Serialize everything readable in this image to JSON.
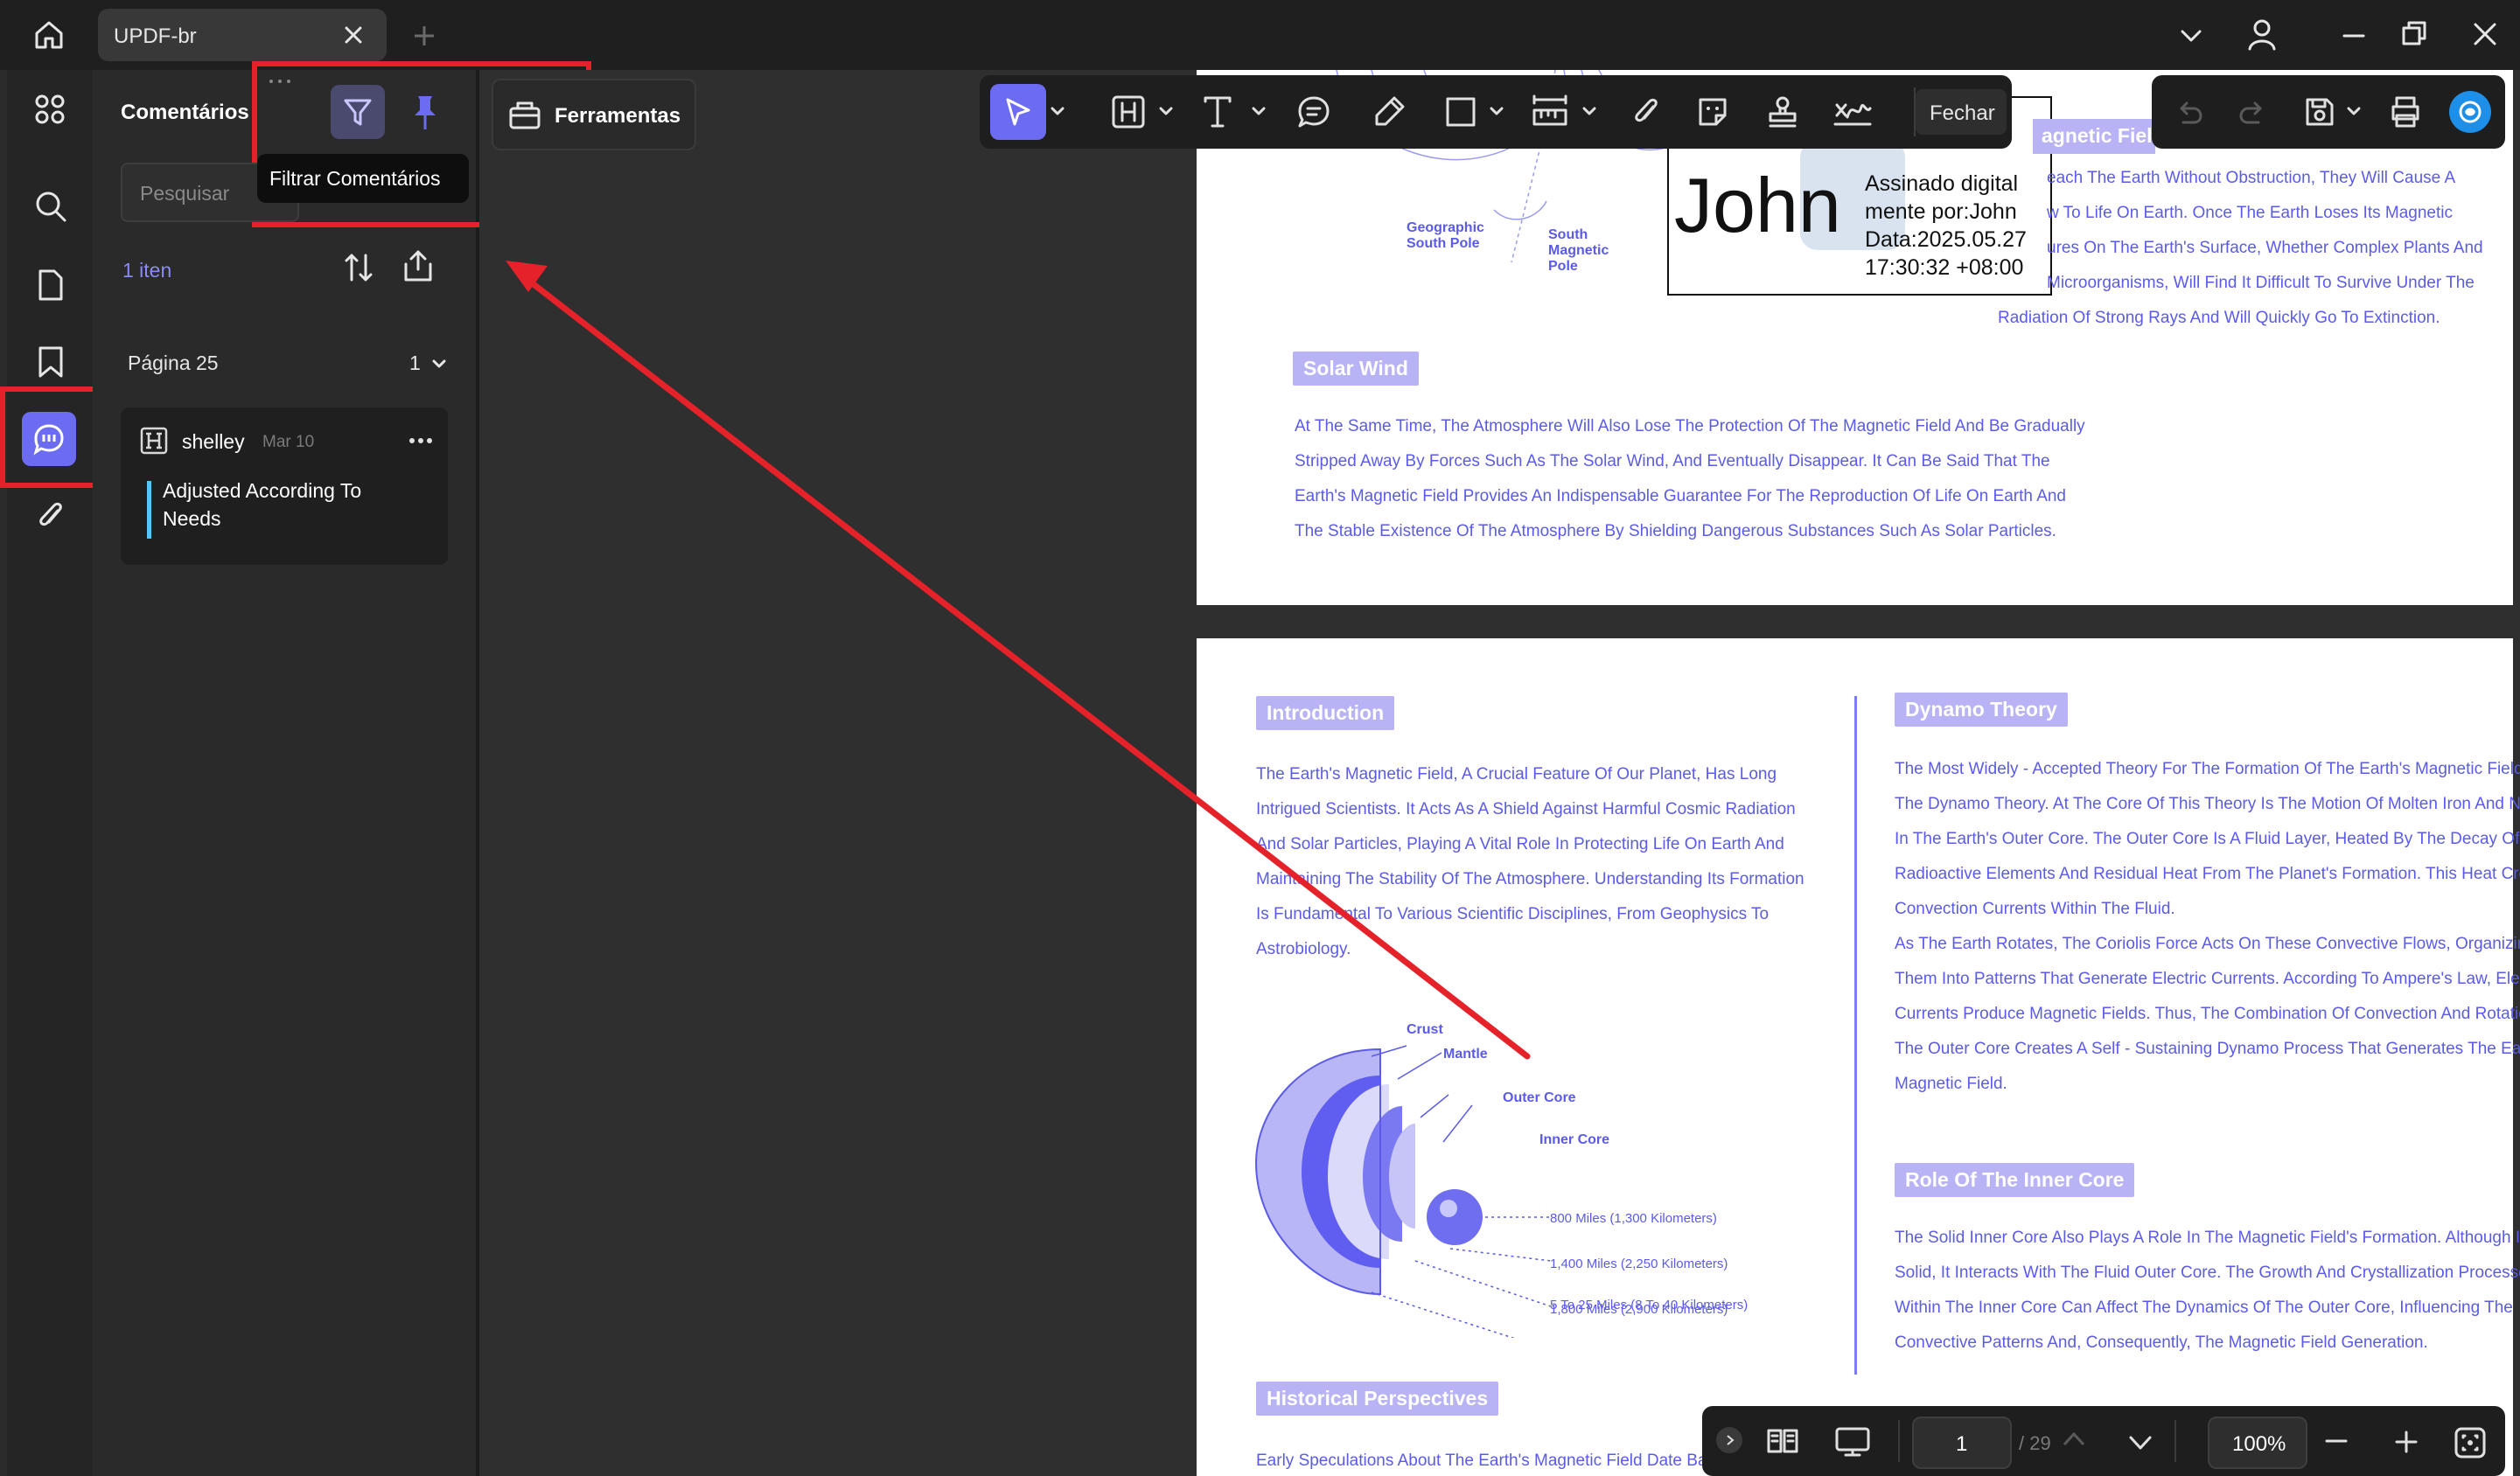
{
  "titlebar": {
    "tab_title": "UPDF-br"
  },
  "panel": {
    "title": "Comentários",
    "tooltip": "Filtrar Comentários",
    "search_placeholder": "Pesquisar",
    "count": "1 iten",
    "page_label": "Página 25",
    "page_count": "1",
    "comment": {
      "author": "shelley",
      "date": "Mar 10",
      "text_line1": "Adjusted According To",
      "text_line2": "Needs"
    }
  },
  "tools": {
    "label": "Ferramentas",
    "close_label": "Fechar"
  },
  "signature": {
    "name": "John",
    "line1": "Assinado digital",
    "line2": "mente por:John",
    "line3": "Data:2025.05.27",
    "line4": "17:30:32 +08:00"
  },
  "page1": {
    "diagram_labels": {
      "geo1": "Geographic",
      "geo2": "South Pole",
      "south1": "South",
      "south2": "Magnetic",
      "south3": "Pole",
      "magnetic_field_partial": "agnetic Fiel"
    },
    "right_lines": [
      "each The Earth Without Obstruction, They Will Cause A",
      "w To Life On Earth. Once The Earth Loses Its Magnetic",
      "ures On The Earth's Surface, Whether Complex Plants And",
      "Microorganisms, Will Find It Difficult To Survive Under The",
      "Radiation Of Strong Rays And Will Quickly Go To Extinction."
    ],
    "solar_heading": "Solar Wind",
    "solar_lines": [
      "At The Same Time, The Atmosphere Will Also Lose The Protection Of The Magnetic Field And Be Gradually",
      "Stripped Away By Forces Such As The Solar Wind, And Eventually Disappear. It Can Be Said That The",
      "Earth's Magnetic Field Provides An Indispensable Guarantee For The Reproduction Of Life On Earth And",
      "The Stable Existence Of The Atmosphere By Shielding Dangerous Substances Such As Solar Particles."
    ]
  },
  "page2": {
    "intro_heading": "Introduction",
    "intro_lines": [
      "The Earth's Magnetic Field, A Crucial Feature Of Our Planet, Has Long",
      "Intrigued Scientists. It Acts As A Shield Against Harmful Cosmic Radiation",
      "And Solar Particles, Playing A Vital Role In Protecting Life On Earth And",
      "Maintaining The Stability Of The Atmosphere. Understanding Its Formation",
      "Is Fundamental To Various Scientific Disciplines, From Geophysics To",
      "Astrobiology."
    ],
    "earth_labels": {
      "crust": "Crust",
      "mantle": "Mantle",
      "outer_core": "Outer Core",
      "inner_core": "Inner Core",
      "d1": "800 Miles (1,300 Kilometers)",
      "d2": "1,400 Miles (2,250 Kilometers)",
      "d3": "1,800 Miles (2,900 Kilometers)",
      "d4": "5 To 25 Miles (8 To 40 Kilometers)"
    },
    "dynamo_heading": "Dynamo Theory",
    "dynamo_lines": [
      "The Most Widely - Accepted Theory For The Formation Of The Earth's Magnetic Field",
      "The Dynamo Theory. At The Core Of This Theory Is The Motion Of Molten Iron And N",
      "In The Earth's Outer Core. The Outer Core Is A Fluid Layer, Heated By The Decay Of",
      "Radioactive Elements And Residual Heat From The Planet's Formation. This Heat Cre",
      "Convection Currents Within The Fluid.",
      "As The Earth Rotates, The Coriolis Force Acts On These Convective Flows, Organizin",
      "Them Into Patterns That Generate Electric Currents. According To Ampere's Law, Ele",
      "Currents Produce Magnetic Fields. Thus, The Combination Of Convection And Rotatio",
      "The Outer Core Creates A Self - Sustaining Dynamo Process That Generates The Ea",
      "Magnetic Field."
    ],
    "inner_heading": "Role Of The Inner Core",
    "inner_lines": [
      "The Solid Inner Core Also Plays A Role In The Magnetic Field's Formation. Although I",
      "Solid, It Interacts With The Fluid Outer Core. The Growth And Crystallization Processe",
      "Within The Inner Core Can Affect The Dynamics Of The Outer Core, Influencing The",
      "Convective Patterns And, Consequently, The Magnetic Field Generation."
    ],
    "historical_heading": "Historical Perspectives",
    "historical_line": "Early Speculations About The Earth's Magnetic Field Date Ba"
  },
  "bottom_bar": {
    "page_input": "1",
    "page_total": "/ 29",
    "zoom": "100%"
  },
  "colors": {
    "accent": "#6b6cf2",
    "red": "#e5222a",
    "text_blue": "#5b5be8"
  }
}
